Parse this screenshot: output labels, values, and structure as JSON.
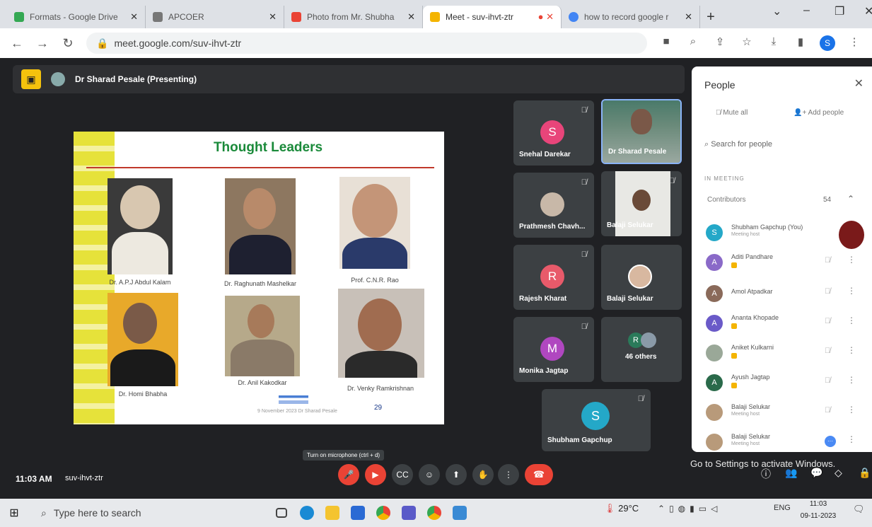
{
  "browser": {
    "tabs": [
      {
        "title": "Formats - Google Drive",
        "color": "#34a853"
      },
      {
        "title": "APCOER",
        "color": "#555555"
      },
      {
        "title": "Photo from Mr. Shubha",
        "color": "#ea4335"
      },
      {
        "title": "Meet - suv-ihvt-ztr",
        "color": "#f4b400"
      },
      {
        "title": "how to record google r",
        "color": "#4285f4"
      }
    ],
    "new_tab": "+",
    "url": "meet.google.com/suv-ihvt-ztr",
    "profile_initial": "S"
  },
  "meet": {
    "presenter_label": "Dr Sharad Pesale (Presenting)",
    "slide": {
      "title": "Thought Leaders",
      "captions": [
        "Dr. A.P.J Abdul Kalam",
        "Dr. Raghunath Mashelkar",
        "Prof. C.N.R. Rao",
        "Dr. Homi Bhabha",
        "Dr. Anil Kakodkar",
        "Dr. Venky Ramkrishnan"
      ],
      "footer": "9 November 2023   Dr Sharad Pesale",
      "page_number": "29"
    },
    "tiles": [
      {
        "name": "Snehal Darekar",
        "initial": "S",
        "color": "#e8457a"
      },
      {
        "name": "Dr Sharad Pesale",
        "initial": ""
      },
      {
        "name": "Prathmesh Chavh...",
        "initial": ""
      },
      {
        "name": "Balaji Selukar",
        "initial": ""
      },
      {
        "name": "Rajesh Kharat",
        "initial": "R",
        "color": "#e85a6a"
      },
      {
        "name": "Balaji Selukar",
        "initial": ""
      },
      {
        "name": "Monika Jagtap",
        "initial": "M",
        "color": "#b047c0"
      },
      {
        "name": "46 others",
        "initial": "R"
      },
      {
        "name": "Shubham Gapchup",
        "initial": "S",
        "color": "#24a8c8"
      }
    ],
    "people_panel": {
      "title": "People",
      "mute_all": "Mute all",
      "add_people": "Add people",
      "search_placeholder": "Search for people",
      "section": "IN MEETING",
      "group": "Contributors",
      "count": "54",
      "people": [
        {
          "name": "Shubham Gapchup (You)",
          "sub": "Meeting host",
          "initial": "S",
          "color": "#24a8c8"
        },
        {
          "name": "Aditi Pandhare",
          "sub": "",
          "initial": "A",
          "color": "#8a6ac8"
        },
        {
          "name": "Amol Atpadkar",
          "sub": "",
          "initial": "A",
          "color": "#8a6a5a"
        },
        {
          "name": "Ananta Khopade",
          "sub": "",
          "initial": "A",
          "color": "#6a5ac8"
        },
        {
          "name": "Aniket Kulkarni",
          "sub": "",
          "initial": "",
          "color": "#9aa898"
        },
        {
          "name": "Ayush Jagtap",
          "sub": "",
          "initial": "A",
          "color": "#2a6a4a"
        },
        {
          "name": "Balaji Selukar",
          "sub": "Meeting host",
          "initial": "",
          "color": "#b89a7a"
        },
        {
          "name": "Balaji Selukar",
          "sub": "Meeting host",
          "initial": "",
          "color": "#b89a7a"
        }
      ]
    },
    "time": "11:03 AM",
    "code": "suv-ihvt-ztr",
    "tooltip": "Turn on microphone (ctrl + d)",
    "activate_text": "Go to Settings to activate Windows."
  },
  "taskbar": {
    "search_placeholder": "Type here to search",
    "weather": "29°C",
    "language": "ENG",
    "time": "11:03",
    "date": "09-11-2023"
  }
}
